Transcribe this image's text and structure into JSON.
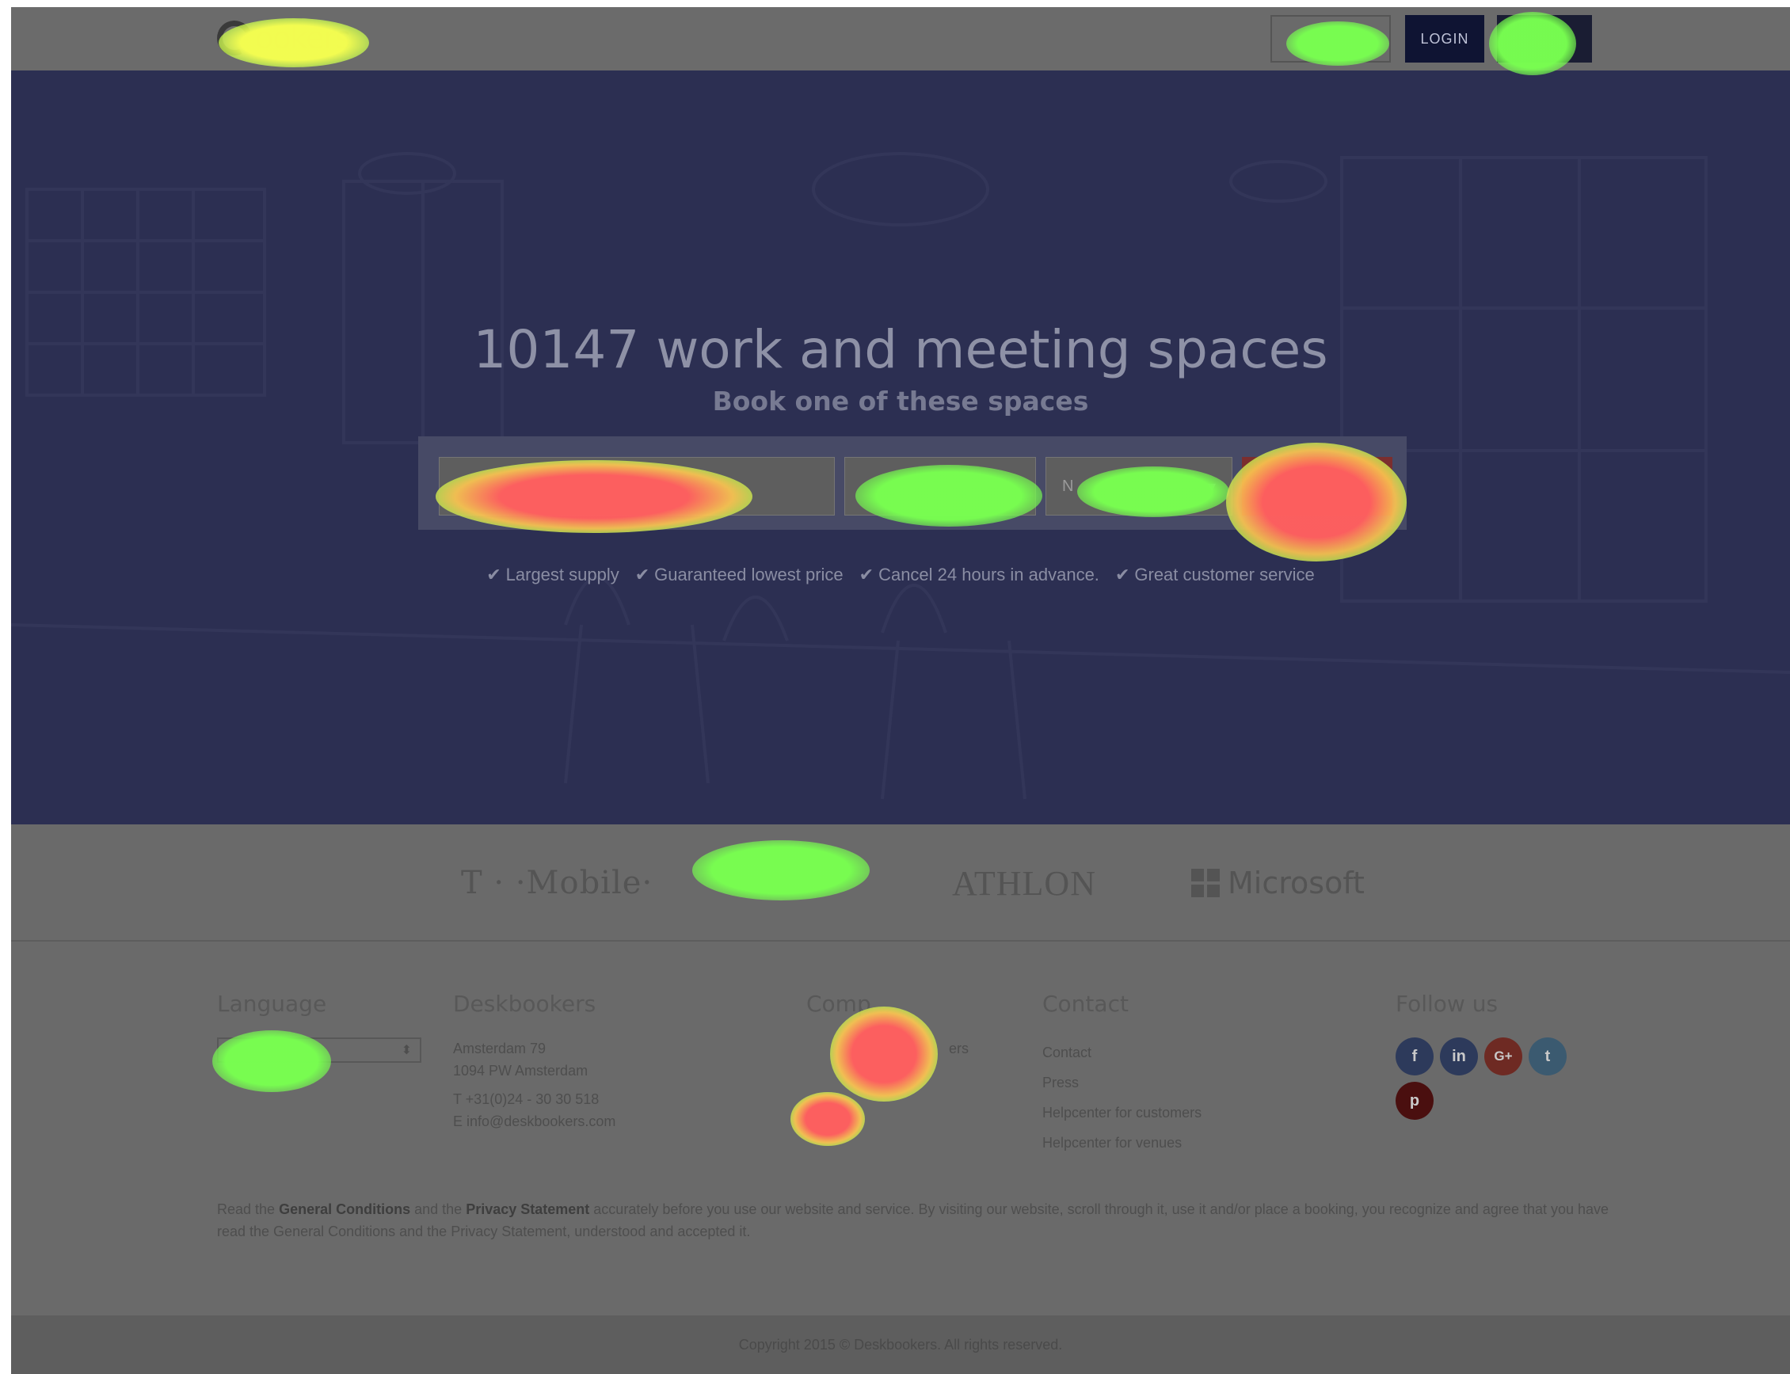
{
  "header": {
    "logo_text": "ookers",
    "login_label": "LOGIN"
  },
  "hero": {
    "title": "10147 work and meeting spaces",
    "subtitle": "Book one of these spaces",
    "select_prefix": "N",
    "select_caret": "▾",
    "usps": [
      {
        "check": "✔",
        "label": "Largest supply"
      },
      {
        "check": "✔",
        "label": "Guaranteed lowest price"
      },
      {
        "check": "✔",
        "label": "Cancel 24 hours in advance."
      },
      {
        "check": "✔",
        "label": "Great customer service"
      }
    ]
  },
  "clients": {
    "tmobile": "T · ·Mobile·",
    "athlon": "ATHLON",
    "microsoft": "Microsoft"
  },
  "footer": {
    "language_heading": "Language",
    "language_caret": "⬍",
    "deskbookers_heading": "Deskbookers",
    "address_line1": "Amsterdam 79",
    "address_line2": "1094 PW Amsterdam",
    "phone": "T +31(0)24 - 30 30 518",
    "email": "E info@deskbookers.com",
    "company_heading": "Comp",
    "company_link_end": "ers",
    "contact_heading": "Contact",
    "contact_links": [
      "Contact",
      "Press",
      "Helpcenter for customers",
      "Helpcenter for venues"
    ],
    "follow_heading": "Follow us",
    "social": [
      {
        "icon": "facebook-icon",
        "glyph": "f"
      },
      {
        "icon": "linkedin-icon",
        "glyph": "in"
      },
      {
        "icon": "google-plus-icon",
        "glyph": "G+"
      },
      {
        "icon": "twitter-icon",
        "glyph": "t"
      },
      {
        "icon": "pinterest-icon",
        "glyph": "p"
      }
    ],
    "legal_read": "Read the",
    "legal_gc": "General Conditions",
    "legal_and": "and the",
    "legal_ps": "Privacy Statement",
    "legal_rest": "accurately before you use our website and service. By visiting our website, scroll through it, use it and/or place a booking, you recognize and agree that you have read the General Conditions and the Privacy Statement, understood and accepted it."
  },
  "copyright": "Copyright 2015 © Deskbookers. All rights reserved.",
  "colors": {
    "overlay": "#6a6a6a",
    "hero_bg": "#2c2f52",
    "login_bg": "#0f1433",
    "heat_red": "#ff5f5f",
    "heat_green": "#78ff50",
    "heat_yellow": "#f5ff50"
  }
}
